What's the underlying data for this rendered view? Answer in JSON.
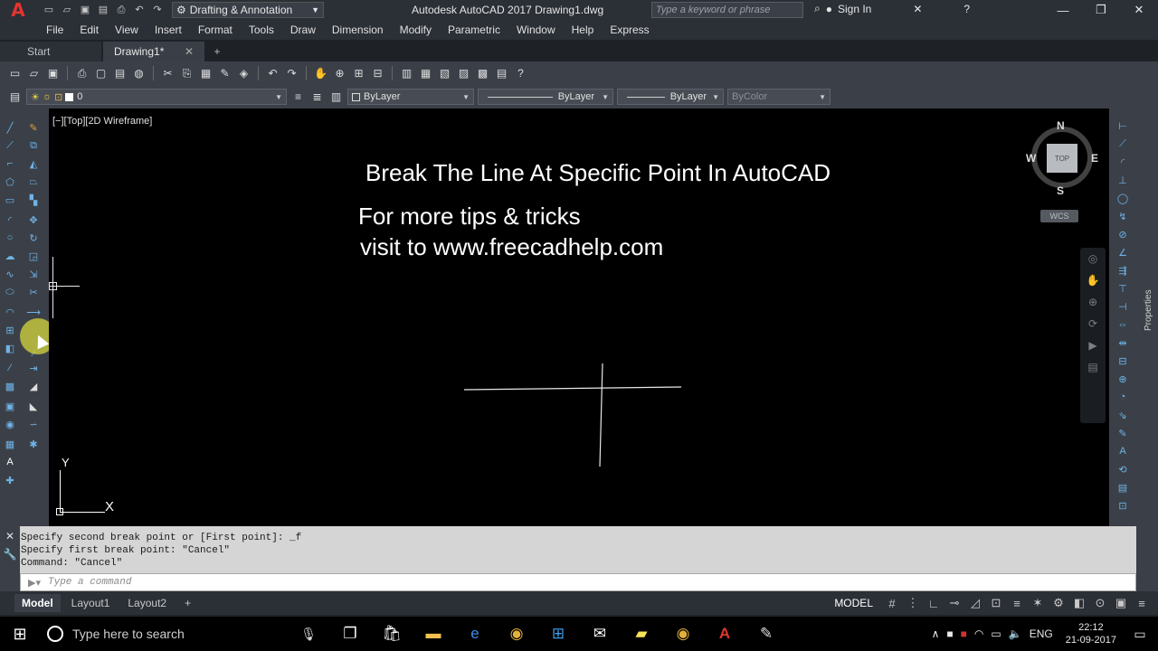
{
  "titlebar": {
    "app_logo": "A",
    "workspace": "Drafting & Annotation",
    "title": "Autodesk AutoCAD 2017    Drawing1.dwg",
    "search_placeholder": "Type a keyword or phrase",
    "sign_in": "Sign In"
  },
  "menu": {
    "items": [
      "File",
      "Edit",
      "View",
      "Insert",
      "Format",
      "Tools",
      "Draw",
      "Dimension",
      "Modify",
      "Parametric",
      "Window",
      "Help",
      "Express"
    ]
  },
  "tabs": {
    "start": "Start",
    "drawing": "Drawing1*"
  },
  "properties_bar": {
    "layer": "0",
    "color": "ByLayer",
    "linetype": "ByLayer",
    "lineweight": "ByLayer",
    "plotstyle": "ByColor"
  },
  "canvas": {
    "viewport_label": "[−][Top][2D Wireframe]",
    "heading": "Break The Line At Specific Point In AutoCAD",
    "tip_line1": "For more tips & tricks",
    "tip_line2": "visit to www.freecadhelp.com",
    "ucs_y": "Y",
    "ucs_x": "X"
  },
  "viewcube": {
    "top": "TOP",
    "n": "N",
    "s": "S",
    "e": "E",
    "w": "W",
    "wcs": "WCS"
  },
  "command": {
    "lines": [
      "Specify second break point or [First point]: _f",
      "Specify first break point: \"Cancel\"",
      "Command: \"Cancel\""
    ],
    "placeholder": "Type a command"
  },
  "status": {
    "layouts": [
      "Model",
      "Layout1",
      "Layout2"
    ],
    "model_label": "MODEL",
    "properties_tab": "Properties"
  },
  "taskbar": {
    "search_placeholder": "Type here to search",
    "language": "ENG",
    "time": "22:12",
    "date": "21-09-2017"
  }
}
